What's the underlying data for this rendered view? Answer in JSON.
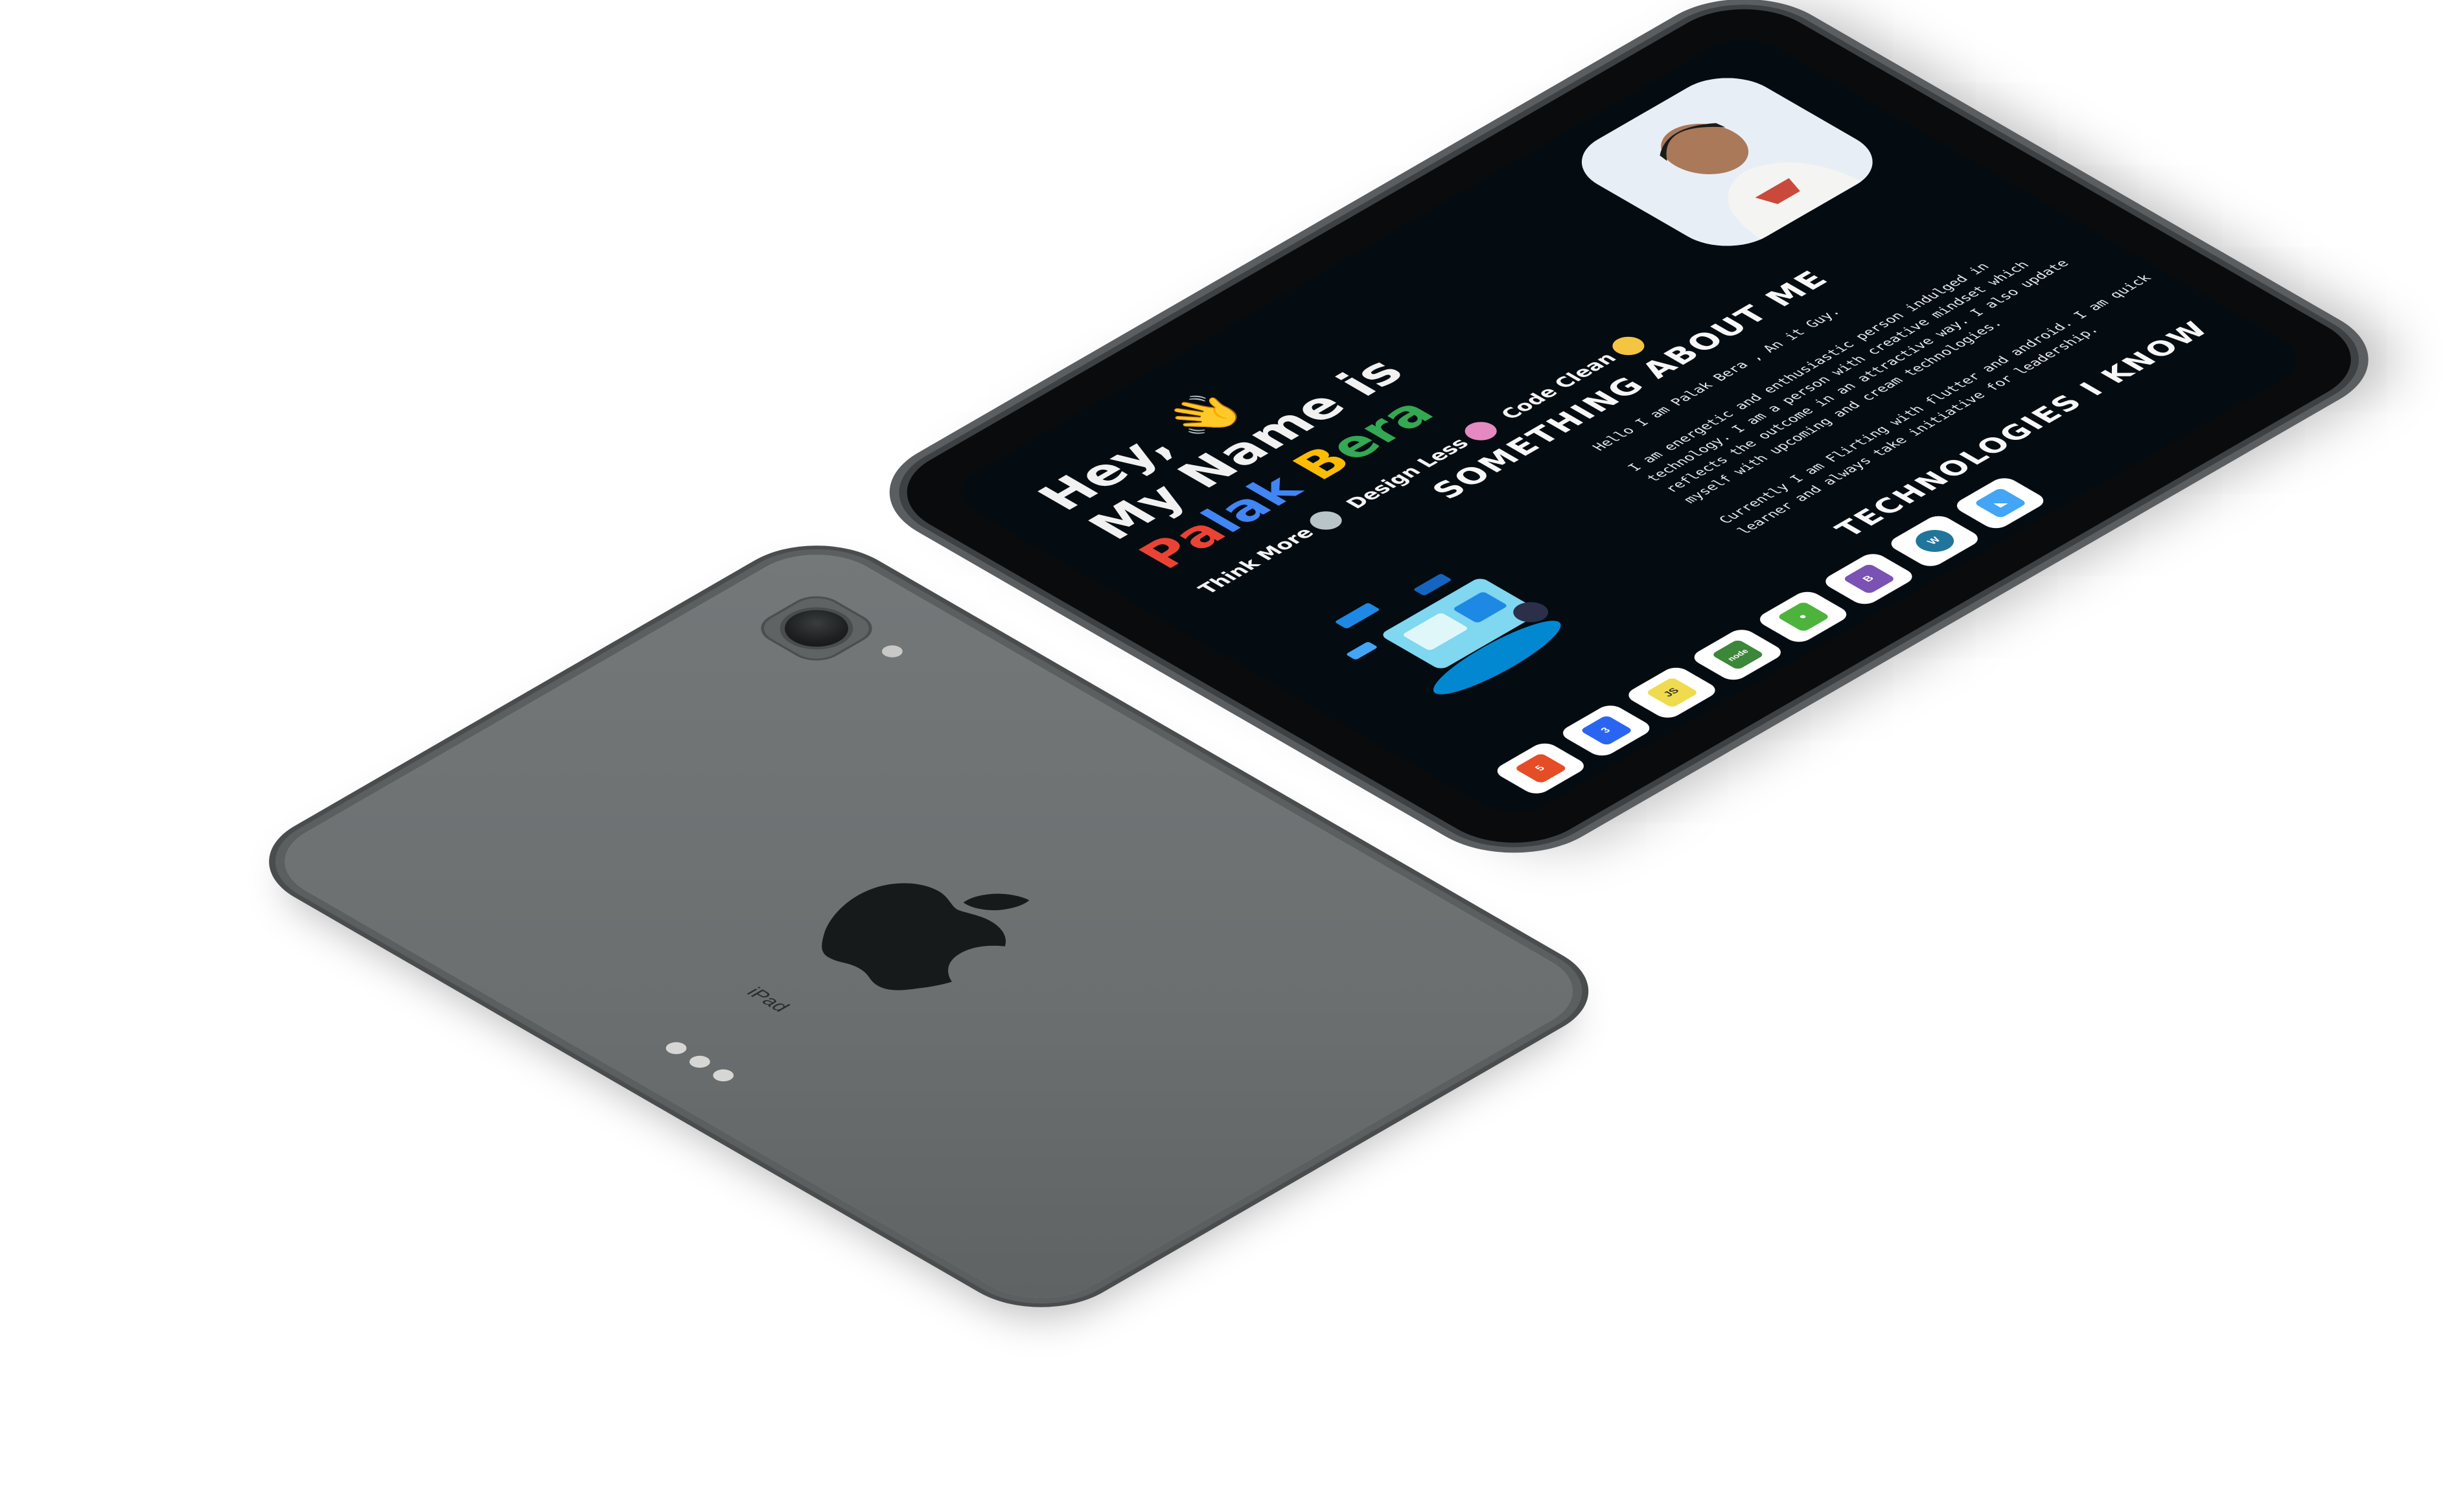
{
  "device": {
    "back_label": "iPad",
    "colors": {
      "body": "#6c7071",
      "frame": "#4a4d4e",
      "screen": "#040c12"
    }
  },
  "hero": {
    "greeting": "Hey, 👋",
    "line2": "My Name is",
    "name_parts": [
      {
        "text": "P",
        "color": "#ea4335"
      },
      {
        "text": "a",
        "color": "#ea4335"
      },
      {
        "text": "l",
        "color": "#4285f4"
      },
      {
        "text": "a",
        "color": "#4285f4"
      },
      {
        "text": "k",
        "color": "#4285f4"
      },
      {
        "text": " ",
        "color": "#ffffff"
      },
      {
        "text": "B",
        "color": "#fbbc05"
      },
      {
        "text": "e",
        "color": "#34a853"
      },
      {
        "text": "r",
        "color": "#34a853"
      },
      {
        "text": "a",
        "color": "#34a853"
      }
    ]
  },
  "taglines": [
    "Think More",
    "Design Less",
    "Code Clean"
  ],
  "about": {
    "title": "SOMETHING ABOUT ME",
    "paragraphs": [
      "Hello I am Palak Bera , An it Guy.",
      "I am energetic and enthusiastic person indulged in technology. I am a person with creative mindset which reflects the outcome in an attractive way. I also update myself with upcoming and cream technologies.",
      "Currently I am Flirting with flutter and android. I am quick learner and always take initiative for leadership."
    ]
  },
  "technologies": {
    "title": "TECHNOLOGIES I KNOW",
    "items": [
      {
        "name": "html5-icon",
        "label": "5",
        "color": "#e44d26"
      },
      {
        "name": "css3-icon",
        "label": "3",
        "color": "#2965f1"
      },
      {
        "name": "javascript-icon",
        "label": "JS",
        "color": "#f0db4f"
      },
      {
        "name": "nodejs-icon",
        "label": "node",
        "color": "#3c873a"
      },
      {
        "name": "mongodb-icon",
        "label": "●",
        "color": "#4db33d"
      },
      {
        "name": "bootstrap-icon",
        "label": "B",
        "color": "#7952b3"
      },
      {
        "name": "wordpress-icon",
        "label": "W",
        "color": "#21759b"
      },
      {
        "name": "flutter-icon",
        "label": "◣",
        "color": "#42a5f5"
      }
    ]
  }
}
